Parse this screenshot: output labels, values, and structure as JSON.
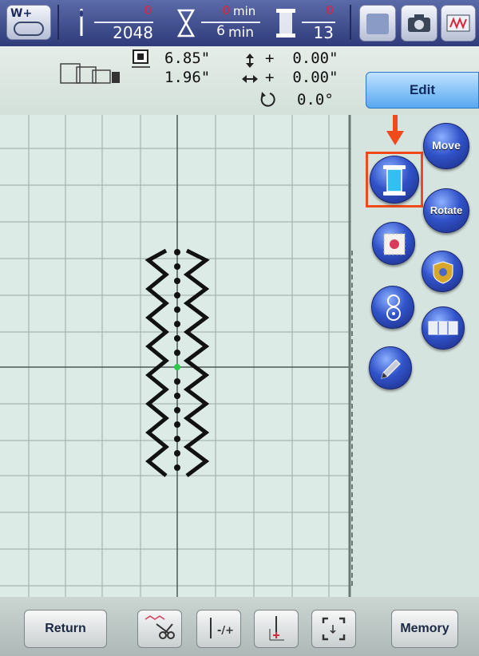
{
  "status": {
    "stitch": {
      "current": "0",
      "total": "2048"
    },
    "time": {
      "current": "0",
      "current_unit": "min",
      "total": "6",
      "total_unit": "min"
    },
    "color": {
      "current": "0",
      "total": "13"
    },
    "machine_badge": "W+"
  },
  "info": {
    "width": "6.85\"",
    "height": "1.96\"",
    "offset_v": "+  0.00\"",
    "offset_h": "+  0.00\"",
    "rotation": "0.0°"
  },
  "side_panel": {
    "edit_tab": "Edit",
    "move": "Move",
    "rotate": "Rotate"
  },
  "bottom": {
    "return": "Return",
    "memory": "Memory"
  },
  "colors": {
    "highlight": "#f04a1a",
    "arrow": "#f04a1a",
    "orb": "#2b45b8",
    "status_red": "#e0243a"
  },
  "icons": [
    "needle-icon",
    "hourglass-icon",
    "thread-spool-icon",
    "hoop-icon",
    "move-icon",
    "rotate-icon",
    "scissors-icon",
    "needle-adjust-icon",
    "needle-position-icon",
    "trial-frame-icon"
  ]
}
